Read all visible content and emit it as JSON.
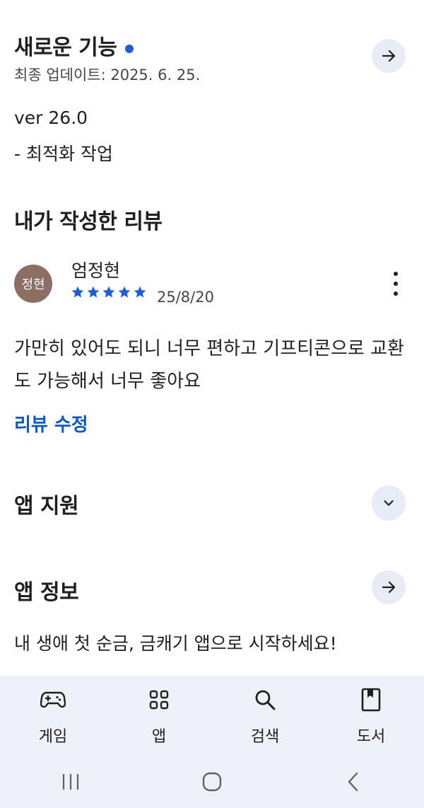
{
  "whats_new": {
    "title": "새로운 기능",
    "updated": "최종 업데이트: 2025. 6. 25.",
    "version": "ver 26.0",
    "note": "- 최적화 작업"
  },
  "my_review": {
    "title": "내가 작성한 리뷰",
    "avatar_text": "정현",
    "reviewer": "엄정현",
    "rating": 5,
    "date": "25/8/20",
    "text": "가만히 있어도 되니 너무 편하고 기프티콘으로 교환도 가능해서 너무 좋아요",
    "edit_label": "리뷰 수정"
  },
  "app_support": {
    "title": "앱 지원"
  },
  "app_info": {
    "title": "앱 정보",
    "description": "내 생애 첫 순금, 금캐기 앱으로 시작하세요!"
  },
  "bottom_nav": [
    {
      "label": "게임",
      "icon": "gamepad-icon"
    },
    {
      "label": "앱",
      "icon": "apps-grid-icon"
    },
    {
      "label": "검색",
      "icon": "search-icon"
    },
    {
      "label": "도서",
      "icon": "book-icon"
    }
  ],
  "colors": {
    "accent": "#0b57d0",
    "star": "#1a5fd6",
    "button_bg": "#e8ecf6",
    "nav_bg": "#eef1f7",
    "avatar_bg": "#8d6e63"
  }
}
